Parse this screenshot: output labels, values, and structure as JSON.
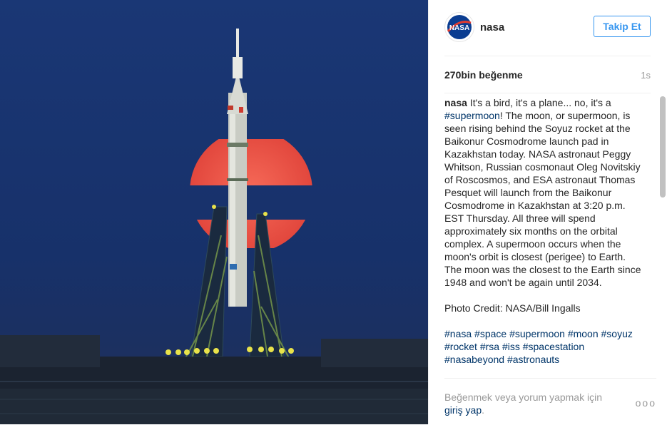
{
  "post": {
    "photo_alt": "Soyuz rocket on launch pad with supermoon rising behind",
    "photo_colors": {
      "sky": "#17326a",
      "moon": "#f0584a",
      "ground": "#1b2330"
    }
  },
  "header": {
    "username": "nasa",
    "avatar_icon": "nasa-logo-icon",
    "avatar_text": "NASA",
    "follow_label": "Takip Et",
    "accent_color": "#3897f0"
  },
  "stats": {
    "likes": "270bin beğenme",
    "time": "1s"
  },
  "caption": {
    "owner": "nasa",
    "part1": " It's a bird, it's a plane... no, it's a ",
    "tag1": "#supermoon",
    "part2": "! The moon, or supermoon, is seen rising behind the Soyuz rocket at the Baikonur Cosmodrome launch pad in Kazakhstan today. NASA astronaut Peggy Whitson, Russian cosmonaut Oleg Novitskiy of Roscosmos, and ESA astronaut Thomas Pesquet will launch from the Baikonur Cosmodrome in Kazakhstan at 3:20 p.m. EST Thursday. All three will spend approximately six months on the orbital complex. A supermoon occurs when the moon's orbit is closest (perigee) to Earth. The moon was the closest to the Earth since 1948 and won't be again until 2034.",
    "credit": "Photo Credit: NASA/Bill Ingalls",
    "hashtags": [
      "#nasa",
      "#space",
      "#supermoon",
      "#moon",
      "#soyuz",
      "#rocket",
      "#rsa",
      "#iss",
      "#spacestation",
      "#nasabeyond",
      "#astronauts"
    ]
  },
  "footer": {
    "login_prefix": "Beğenmek veya yorum yapmak için ",
    "login_link": "giriş yap",
    "login_suffix": ".",
    "more_label": "ooo",
    "more_icon": "more-options-icon"
  }
}
